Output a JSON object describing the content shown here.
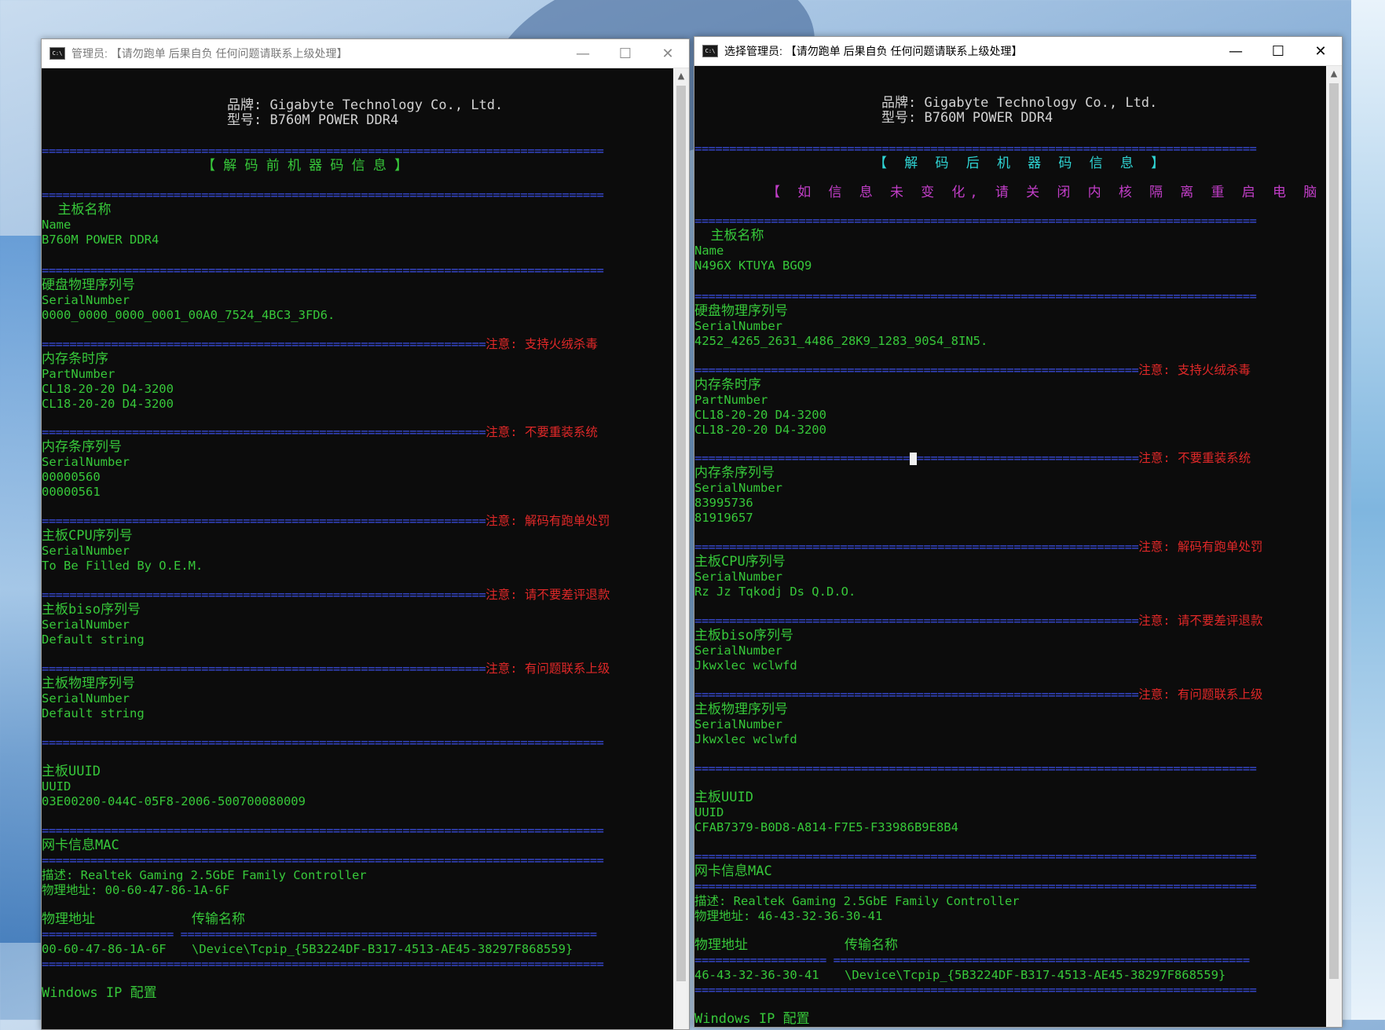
{
  "left": {
    "title_prefix": "管理员:",
    "title": "【请勿跑单 后果自负 任何问题请联系上级处理】",
    "brand_line": "品牌: Gigabyte Technology Co., Ltd.",
    "model_line": "型号: B760M POWER DDR4",
    "section_header": "【 解 码 前 机 器 码 信 息 】",
    "sep": "=================================================================================",
    "sep_short": "================================================================",
    "board_name_label": "  主板名称",
    "name_key": "Name",
    "board_name": "B760M POWER DDR4",
    "disk_label": "硬盘物理序列号",
    "serial_key": "SerialNumber",
    "disk_serial": "0000_0000_0000_0001_00A0_7524_4BC3_3FD6.",
    "note1": "注意: 支持火绒杀毒",
    "mem_timing_label": "内存条时序",
    "part_key": "PartNumber",
    "mem_timing_1": "CL18-20-20 D4-3200",
    "mem_timing_2": "CL18-20-20 D4-3200",
    "note2": "注意: 不要重装系统",
    "mem_serial_label": "内存条序列号",
    "mem_serial_1": "00000560",
    "mem_serial_2": "00000561",
    "note3": "注意: 解码有跑单处罚",
    "cpu_label": "主板CPU序列号",
    "cpu_serial": "To Be Filled By O.E.M.",
    "note4": "注意: 请不要差评退款",
    "bios_label": "主板biso序列号",
    "bios_serial": "Default string",
    "note5": "注意: 有问题联系上级",
    "board_phys_label": "主板物理序列号",
    "board_phys_serial": "Default string",
    "uuid_label": "主板UUID",
    "uuid_key": "UUID",
    "uuid": "03E00200-044C-05F8-2006-500700080009",
    "mac_label": "网卡信息MAC",
    "nic_desc": "描述: Realtek Gaming 2.5GbE Family Controller",
    "nic_phys": "物理地址: 00-60-47-86-1A-6F",
    "col_phys": "物理地址",
    "col_transport": "传输名称",
    "col_sep": "=================== ============================================================",
    "mac_value": "00-60-47-86-1A-6F",
    "transport_value": "\\Device\\Tcpip_{5B3224DF-B317-4513-AE45-38297F868559}",
    "ip_config": "Windows IP 配置"
  },
  "right": {
    "title_prefix": "选择管理员:",
    "title": "【请勿跑单 后果自负 任何问题请联系上级处理】",
    "brand_line": "品牌: Gigabyte Technology Co., Ltd.",
    "model_line": "型号: B760M POWER DDR4",
    "section_header": "【 解 码 后 机 器 码 信 息 】",
    "notice": "【 如 信 息 未 变 化, 请 关 闭 内 核 隔 离 重 启 电 脑 即 可! 】",
    "sep": "=================================================================================",
    "sep_short": "================================================================",
    "board_name_label": "  主板名称",
    "name_key": "Name",
    "board_name": "N496X KTUYA BGQ9",
    "disk_label": "硬盘物理序列号",
    "serial_key": "SerialNumber",
    "disk_serial": "4252_4265_2631_4486_28K9_1283_90S4_8IN5.",
    "note1": "注意: 支持火绒杀毒",
    "mem_timing_label": "内存条时序",
    "part_key": "PartNumber",
    "mem_timing_1": "CL18-20-20 D4-3200",
    "mem_timing_2": "CL18-20-20 D4-3200",
    "note2": "注意: 不要重装系统",
    "sep_a": "===============================",
    "sep_b": "================================",
    "mem_serial_label": "内存条序列号",
    "mem_serial_1": "83995736",
    "mem_serial_2": "81919657",
    "note3": "注意: 解码有跑单处罚",
    "cpu_label": "主板CPU序列号",
    "cpu_serial": "Rz Jz Tqkodj Ds Q.D.O.",
    "note4": "注意: 请不要差评退款",
    "bios_label": "主板biso序列号",
    "bios_serial": "Jkwxlec wclwfd",
    "note5": "注意: 有问题联系上级",
    "board_phys_label": "主板物理序列号",
    "board_phys_serial": "Jkwxlec wclwfd",
    "uuid_label": "主板UUID",
    "uuid_key": "UUID",
    "uuid": "CFAB7379-B0D8-A814-F7E5-F33986B9E8B4",
    "mac_label": "网卡信息MAC",
    "nic_desc": "描述: Realtek Gaming 2.5GbE Family Controller",
    "nic_phys": "物理地址: 46-43-32-36-30-41",
    "col_phys": "物理地址",
    "col_transport": "传输名称",
    "col_sep": "=================== ============================================================",
    "mac_value": "46-43-32-36-30-41",
    "transport_value": "\\Device\\Tcpip_{5B3224DF-B317-4513-AE45-38297F868559}",
    "ip_config": "Windows IP 配置"
  },
  "window_buttons": {
    "minimize": "—",
    "maximize": "☐",
    "close": "✕"
  },
  "icons": {
    "cmd": "cmd-icon",
    "scroll_up": "scroll-up-arrow-icon"
  },
  "colors": {
    "separator": "#3c50e8",
    "text_green": "#37c83a",
    "text_white": "#d2d2d2",
    "header_cyan": "#2fd5d5",
    "notice_magenta": "#c23ec8",
    "warning_red": "#e02828"
  }
}
